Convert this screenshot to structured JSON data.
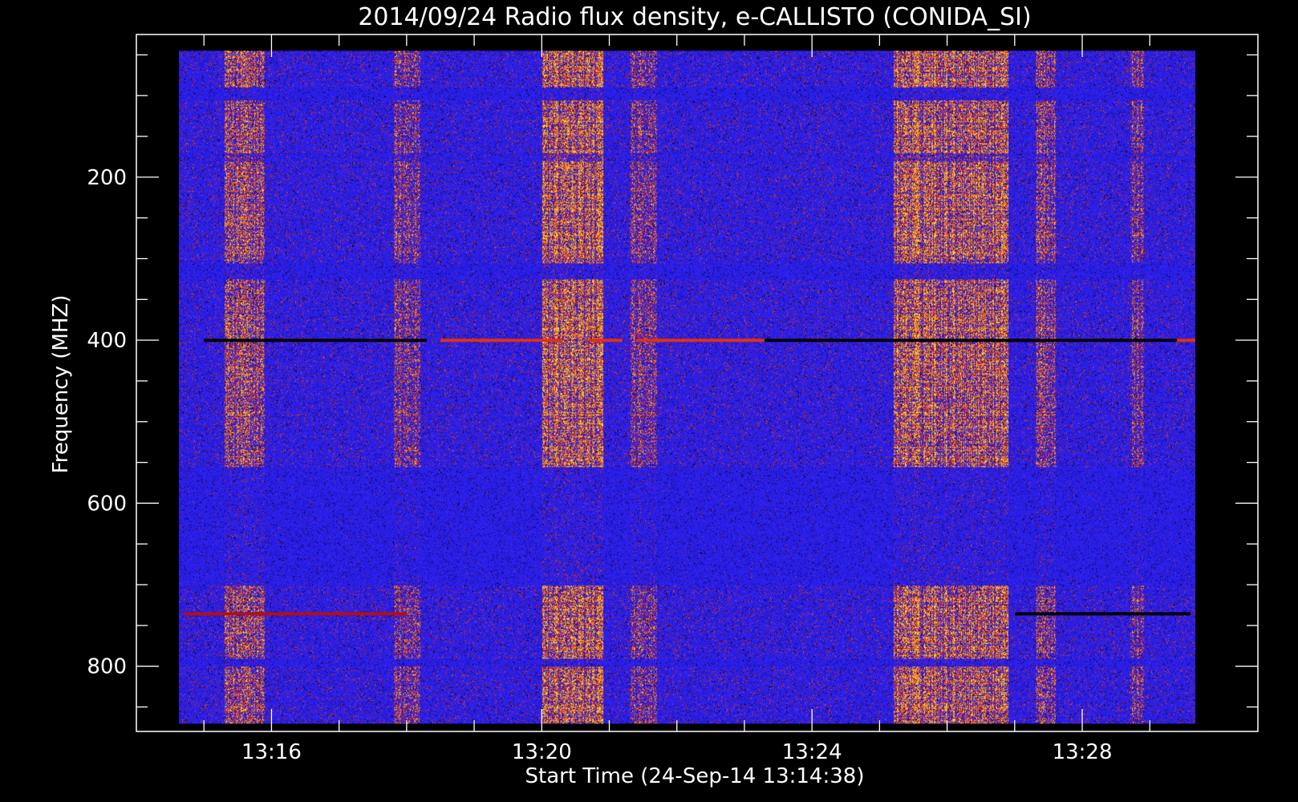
{
  "chart_data": {
    "type": "heatmap",
    "title": "2014/09/24  Radio flux density, e-CALLISTO (CONIDA_SI)",
    "xlabel": "Start Time (24-Sep-14 13:14:38)",
    "ylabel": "Frequency (MHZ)",
    "x_unit": "minutes after 13:00",
    "xlim": [
      14.0,
      30.6
    ],
    "ylim": [
      880,
      25
    ],
    "data_x_range": [
      14.63,
      29.67
    ],
    "data_y_range": [
      45,
      870
    ],
    "x_ticks": [
      {
        "value": 16,
        "label": "13:16"
      },
      {
        "value": 20,
        "label": "13:20"
      },
      {
        "value": 24,
        "label": "13:24"
      },
      {
        "value": 28,
        "label": "13:28"
      }
    ],
    "x_minor_ticks": [
      15,
      17,
      18,
      19,
      21,
      22,
      23,
      25,
      26,
      27,
      29
    ],
    "y_ticks": [
      {
        "value": 200,
        "label": "200"
      },
      {
        "value": 400,
        "label": "400"
      },
      {
        "value": 600,
        "label": "600"
      },
      {
        "value": 800,
        "label": "800"
      }
    ],
    "y_minor_ticks": [
      50,
      100,
      150,
      250,
      300,
      350,
      450,
      500,
      550,
      650,
      700,
      750,
      850
    ],
    "colormap": [
      "#000000",
      "#1a0a8c",
      "#2a1ef2",
      "#3a2ef5",
      "#c0101a",
      "#ff5a10",
      "#ffd030"
    ],
    "burst_time_ranges": [
      [
        15.3,
        15.9
      ],
      [
        17.8,
        18.2
      ],
      [
        20.0,
        20.9
      ],
      [
        21.3,
        21.7
      ],
      [
        25.2,
        26.9
      ],
      [
        27.3,
        27.6
      ],
      [
        28.7,
        28.9
      ]
    ],
    "burst_intensity": [
      0.8,
      0.65,
      1.0,
      0.6,
      1.0,
      0.8,
      0.6
    ],
    "low_intensity_freq_bands": [
      [
        90,
        105
      ],
      [
        305,
        325
      ],
      [
        555,
        700
      ],
      [
        790,
        800
      ]
    ],
    "weak_freq_bands": [
      [
        170,
        180
      ]
    ],
    "narrowband_lines": [
      {
        "freq": 400,
        "time_segments": [
          [
            18.5,
            20.3
          ],
          [
            20.7,
            21.2
          ],
          [
            21.4,
            23.3
          ],
          [
            29.4,
            29.7
          ]
        ],
        "color": "#e03010"
      },
      {
        "freq": 400,
        "time_segments": [
          [
            15.0,
            18.3
          ],
          [
            23.3,
            29.4
          ]
        ],
        "color": "#000000"
      },
      {
        "freq": 735,
        "time_segments": [
          [
            14.7,
            18.0
          ]
        ],
        "color": "#b01010"
      },
      {
        "freq": 735,
        "time_segments": [
          [
            27.0,
            29.6
          ]
        ],
        "color": "#000000"
      }
    ],
    "grid": false,
    "legend": "none"
  }
}
